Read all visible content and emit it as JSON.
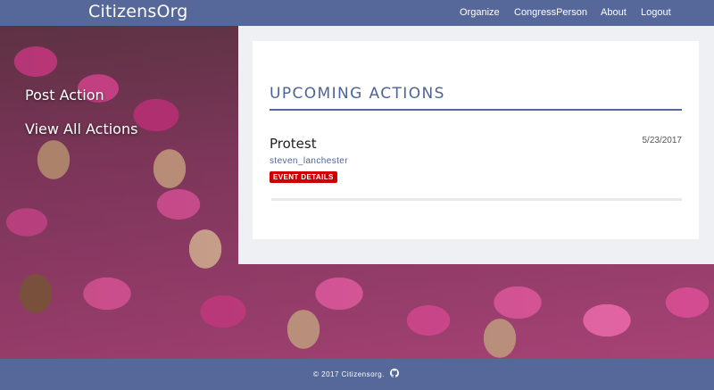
{
  "navbar": {
    "brand": "CitizensOrg",
    "links": [
      "Organize",
      "CongressPerson",
      "About",
      "Logout"
    ]
  },
  "sidebar": {
    "post_action": "Post Action",
    "view_all": "View All Actions"
  },
  "panel": {
    "title": "UPCOMING ACTIONS",
    "actions": [
      {
        "title": "Protest",
        "date": "5/23/2017",
        "user": "steven_lanchester",
        "button": "EVENT DETAILS"
      }
    ]
  },
  "footer": {
    "text": "© 2017 Citizensorg.",
    "icon": "github-icon"
  },
  "colors": {
    "navbar": "#56679a",
    "accent": "#4e6396",
    "button": "#cc0000"
  }
}
